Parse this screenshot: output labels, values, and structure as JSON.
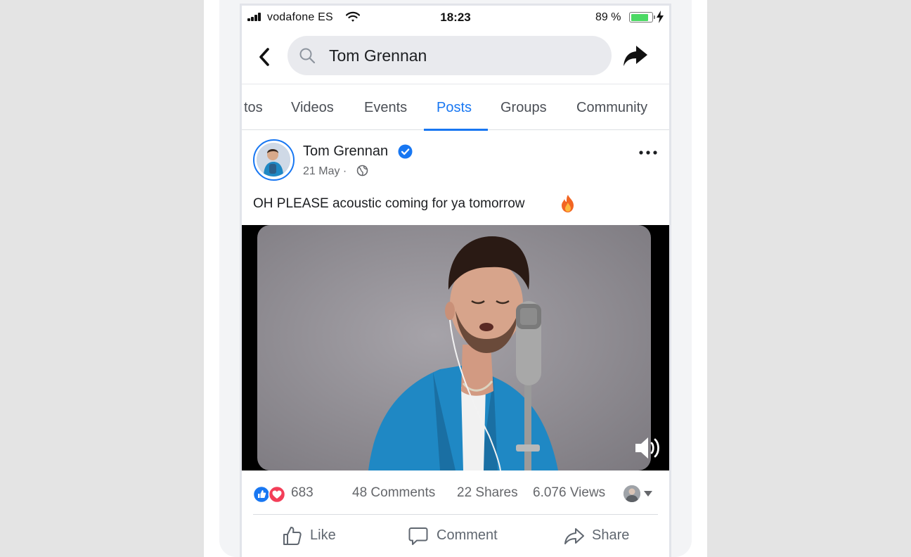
{
  "status_bar": {
    "carrier": "vodafone ES",
    "time": "18:23",
    "battery_percent": "89 %",
    "battery_level": 0.89
  },
  "search": {
    "query": "Tom Grennan"
  },
  "tabs": [
    {
      "label": "tos"
    },
    {
      "label": "Videos"
    },
    {
      "label": "Events"
    },
    {
      "label": "Posts",
      "active": true
    },
    {
      "label": "Groups"
    },
    {
      "label": "Community"
    }
  ],
  "post": {
    "author": "Tom Grennan",
    "date": "21 May",
    "date_separator": "·",
    "text": "OH PLEASE acoustic coming for ya tomorrow",
    "stats": {
      "reactions": "683",
      "comments": "48 Comments",
      "shares": "22 Shares",
      "views": "6.076 Views"
    },
    "actions": {
      "like": "Like",
      "comment": "Comment",
      "share": "Share"
    }
  },
  "colors": {
    "accent": "#1877f2",
    "love": "#f33e58",
    "battery": "#4cd964",
    "jacket": "#1f88c4"
  },
  "icons": [
    "signal-icon",
    "wifi-icon",
    "battery-icon",
    "bolt-icon",
    "back-icon",
    "search-icon",
    "share-icon",
    "verified-icon",
    "globe-icon",
    "more-icon",
    "fire-icon",
    "volume-icon",
    "like-icon",
    "love-icon",
    "caret-down-icon",
    "thumbs-up-icon",
    "comment-icon",
    "share-arrow-icon"
  ]
}
